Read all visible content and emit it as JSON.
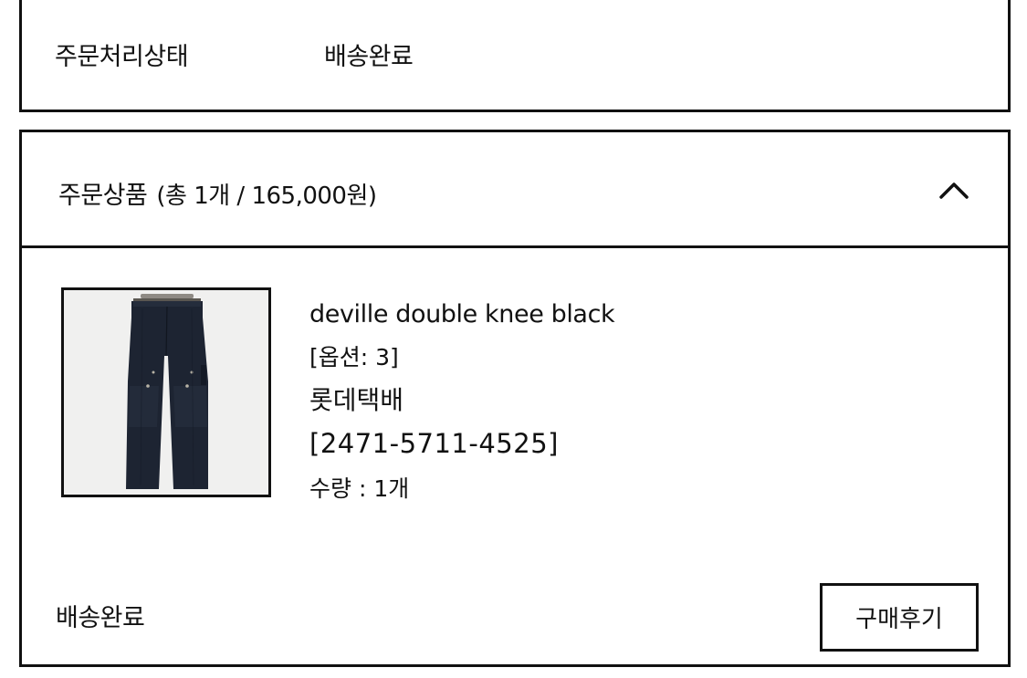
{
  "status_section": {
    "label": "주문처리상태",
    "value": "배송완료"
  },
  "order_items": {
    "title": "주문상품",
    "summary": "(총 1개 / 165,000원)",
    "toggle_icon": "chevron-up-icon",
    "item": {
      "image_alt": "deville double knee black pants",
      "name": "deville double knee black",
      "option": "[옵션: 3]",
      "courier": "롯데택배",
      "tracking": "[2471-5711-4525]",
      "quantity": "수량 : 1개",
      "status": "배송완료",
      "review_button_label": "구매후기"
    }
  },
  "colors": {
    "border": "#111111",
    "background": "#ffffff",
    "text": "#111111",
    "pants": "#1d2432"
  }
}
